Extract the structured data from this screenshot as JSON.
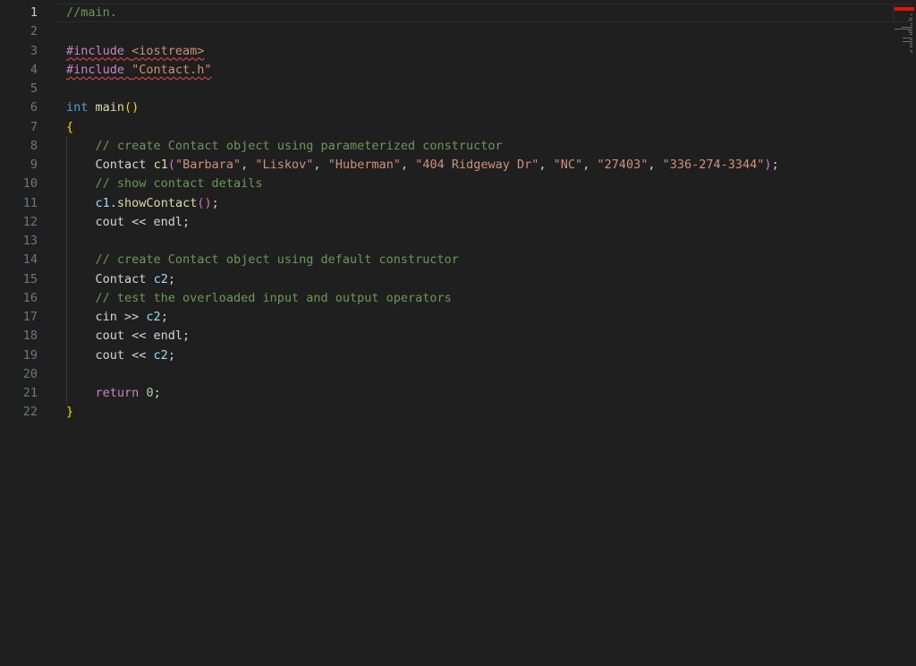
{
  "editor": {
    "active_line": 1,
    "line_numbers": [
      "1",
      "2",
      "3",
      "4",
      "5",
      "6",
      "7",
      "8",
      "9",
      "10",
      "11",
      "12",
      "13",
      "14",
      "15",
      "16",
      "17",
      "18",
      "19",
      "20",
      "21",
      "22"
    ],
    "lines": [
      [
        {
          "t": "//main.",
          "k": "comment"
        }
      ],
      [],
      [
        {
          "t": "#include ",
          "k": "directive",
          "sq": true
        },
        {
          "t": "<iostream>",
          "k": "string",
          "sq": true
        }
      ],
      [
        {
          "t": "#include ",
          "k": "directive",
          "sq": true
        },
        {
          "t": "\"Contact.h\"",
          "k": "string",
          "sq": true
        }
      ],
      [],
      [
        {
          "t": "int",
          "k": "keyword"
        },
        {
          "t": " ",
          "k": "plain"
        },
        {
          "t": "main",
          "k": "func"
        },
        {
          "t": "()",
          "k": "brace1"
        }
      ],
      [
        {
          "t": "{",
          "k": "brace1"
        }
      ],
      [
        {
          "t": "    ",
          "k": "plain"
        },
        {
          "t": "// create Contact object using parameterized constructor",
          "k": "comment"
        }
      ],
      [
        {
          "t": "    ",
          "k": "plain"
        },
        {
          "t": "Contact",
          "k": "type"
        },
        {
          "t": " ",
          "k": "plain"
        },
        {
          "t": "c1",
          "k": "func"
        },
        {
          "t": "(",
          "k": "brace2"
        },
        {
          "t": "\"Barbara\"",
          "k": "string"
        },
        {
          "t": ", ",
          "k": "plain"
        },
        {
          "t": "\"Liskov\"",
          "k": "string"
        },
        {
          "t": ", ",
          "k": "plain"
        },
        {
          "t": "\"Huberman\"",
          "k": "string"
        },
        {
          "t": ", ",
          "k": "plain"
        },
        {
          "t": "\"404 Ridgeway Dr\"",
          "k": "string"
        },
        {
          "t": ", ",
          "k": "plain"
        },
        {
          "t": "\"NC\"",
          "k": "string"
        },
        {
          "t": ", ",
          "k": "plain"
        },
        {
          "t": "\"27403\"",
          "k": "string"
        },
        {
          "t": ", ",
          "k": "plain"
        },
        {
          "t": "\"336-274-3344\"",
          "k": "string"
        },
        {
          "t": ")",
          "k": "brace2"
        },
        {
          "t": ";",
          "k": "plain"
        }
      ],
      [
        {
          "t": "    ",
          "k": "plain"
        },
        {
          "t": "// show contact details",
          "k": "comment"
        }
      ],
      [
        {
          "t": "    ",
          "k": "plain"
        },
        {
          "t": "c1",
          "k": "var"
        },
        {
          "t": ".",
          "k": "plain"
        },
        {
          "t": "showContact",
          "k": "func"
        },
        {
          "t": "()",
          "k": "brace2"
        },
        {
          "t": ";",
          "k": "plain"
        }
      ],
      [
        {
          "t": "    ",
          "k": "plain"
        },
        {
          "t": "cout << endl;",
          "k": "plain"
        }
      ],
      [],
      [
        {
          "t": "    ",
          "k": "plain"
        },
        {
          "t": "// create Contact object using default constructor",
          "k": "comment"
        }
      ],
      [
        {
          "t": "    ",
          "k": "plain"
        },
        {
          "t": "Contact",
          "k": "type"
        },
        {
          "t": " ",
          "k": "plain"
        },
        {
          "t": "c2",
          "k": "var"
        },
        {
          "t": ";",
          "k": "plain"
        }
      ],
      [
        {
          "t": "    ",
          "k": "plain"
        },
        {
          "t": "// test the overloaded input and output operators",
          "k": "comment"
        }
      ],
      [
        {
          "t": "    ",
          "k": "plain"
        },
        {
          "t": "cin >> ",
          "k": "plain"
        },
        {
          "t": "c2",
          "k": "var"
        },
        {
          "t": ";",
          "k": "plain"
        }
      ],
      [
        {
          "t": "    ",
          "k": "plain"
        },
        {
          "t": "cout << endl;",
          "k": "plain"
        }
      ],
      [
        {
          "t": "    ",
          "k": "plain"
        },
        {
          "t": "cout << ",
          "k": "plain"
        },
        {
          "t": "c2",
          "k": "var"
        },
        {
          "t": ";",
          "k": "plain"
        }
      ],
      [],
      [
        {
          "t": "    ",
          "k": "plain"
        },
        {
          "t": "return",
          "k": "control"
        },
        {
          "t": " ",
          "k": "plain"
        },
        {
          "t": "0",
          "k": "num"
        },
        {
          "t": ";",
          "k": "plain"
        }
      ],
      [
        {
          "t": "}",
          "k": "brace1"
        }
      ]
    ]
  },
  "colors": {
    "background": "#1f1f1f",
    "comment": "#6a9955",
    "string": "#ce9178",
    "keyword": "#569cd6",
    "error_marker": "#e51400"
  }
}
